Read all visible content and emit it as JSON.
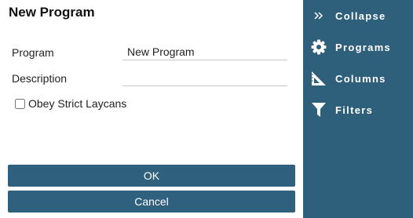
{
  "dialog": {
    "title": "New Program",
    "program_label": "Program",
    "program_value": "New Program",
    "description_label": "Description",
    "description_value": "",
    "obey_strict_laycans_label": "Obey Strict Laycans",
    "ok_label": "OK",
    "cancel_label": "Cancel"
  },
  "sidebar": {
    "items": [
      {
        "label": "Collapse",
        "icon": "double-chevron-right-icon"
      },
      {
        "label": "Programs",
        "icon": "gear-icon"
      },
      {
        "label": "Columns",
        "icon": "set-square-icon"
      },
      {
        "label": "Filters",
        "icon": "funnel-icon"
      }
    ]
  },
  "colors": {
    "accent": "#2f607d",
    "sidebar_bg": "#2e5f7b",
    "text": "#222222"
  }
}
